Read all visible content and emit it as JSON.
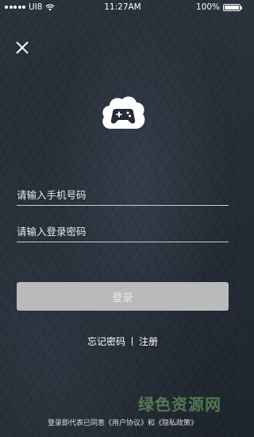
{
  "status_bar": {
    "carrier": "UI8",
    "time": "11:27AM",
    "battery": "100%"
  },
  "icons": {
    "close": "close-icon",
    "logo": "game-cloud-logo-icon",
    "wifi": "wifi-icon",
    "battery": "battery-icon"
  },
  "form": {
    "phone_placeholder": "请输入手机号码",
    "password_placeholder": "请输入登录密码",
    "login_label": "登录"
  },
  "links": {
    "forgot_password": "忘记密码",
    "register": "注册"
  },
  "agreement": {
    "prefix": "登录即代表已同意",
    "user_agreement": "《用户协议》",
    "and": "和",
    "privacy_policy": "《隐私政策》"
  },
  "watermark": {
    "text": "绿色资源网"
  },
  "colors": {
    "background": "#252c35",
    "button": "#b9babb",
    "text": "#ffffff"
  }
}
